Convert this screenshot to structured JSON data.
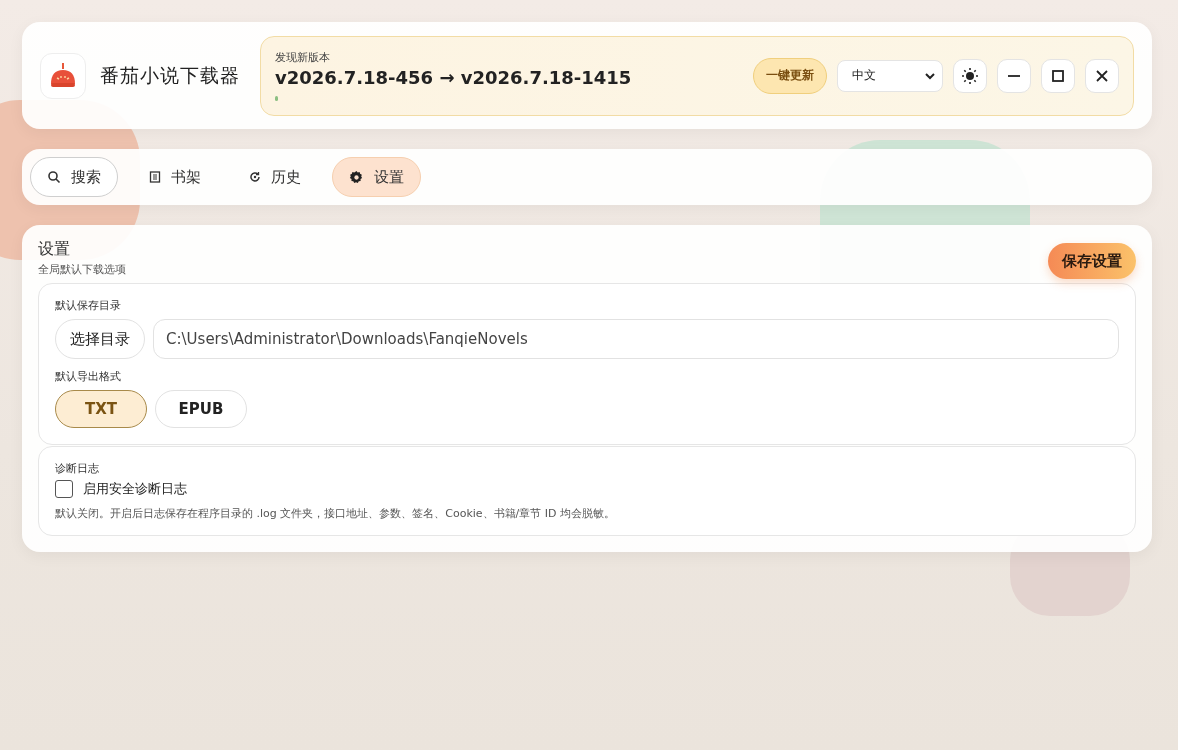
{
  "app": {
    "title": "番茄小说下载器"
  },
  "update": {
    "label": "发现新版本",
    "versions": "v2026.7.18-456 → v2026.7.18-1415",
    "progress": {
      "level": 0.012
    },
    "button": "一键更新"
  },
  "language": {
    "value": "中文"
  },
  "tabs": [
    {
      "label": "搜索",
      "selected": false,
      "hovered": true
    },
    {
      "label": "书架",
      "selected": false,
      "hovered": false
    },
    {
      "label": "历史",
      "selected": false,
      "hovered": false
    },
    {
      "label": "设置",
      "selected": true,
      "hovered": false
    }
  ],
  "settings": {
    "title": "设置",
    "subtitle": "全局默认下载选项",
    "save": "保存设置",
    "directory": {
      "label": "默认保存目录",
      "button": "选择目录",
      "value": "C:\\Users\\Administrator\\Downloads\\FanqieNovels"
    },
    "format": {
      "label": "默认导出格式",
      "options": [
        {
          "label": "TXT",
          "selected": true
        },
        {
          "label": "EPUB",
          "selected": false
        }
      ]
    },
    "log": {
      "label": "诊断日志",
      "checkbox": "启用安全诊断日志",
      "checked": false,
      "note": "默认关闭。开启后日志保存在程序目录的 .log 文件夹，接口地址、参数、签名、Cookie、书籍/章节 ID 均会脱敏。"
    }
  }
}
